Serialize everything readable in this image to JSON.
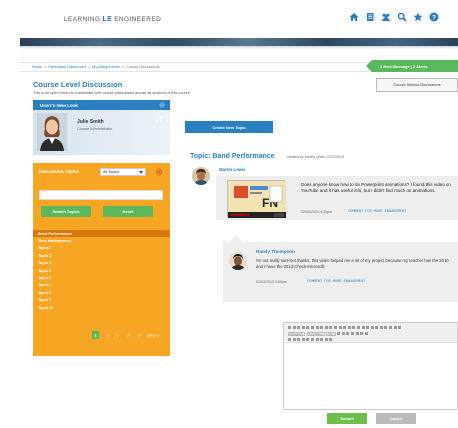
{
  "header": {
    "logo": {
      "part1": "LEARNING",
      "part2": "LE",
      "part3": "ENGINEERED"
    },
    "icons": [
      "home-icon",
      "notebook-icon",
      "group-icon",
      "search-icon",
      "star-icon",
      "help-icon"
    ]
  },
  "breadcrumb": [
    "Home",
    "Participant Dashboard",
    "My Assignments",
    "Course Discussions"
  ],
  "message_tab": "1 New Message | 2 Alerts",
  "page": {
    "title": "Course Level Discussion",
    "description": "This is an open forum to collaborate with course participants across all sections of this course.",
    "section_button": "Course Section Discussions"
  },
  "user": {
    "header": "Userr's New Look",
    "name": "Julie Smith",
    "role": "Course Administrator"
  },
  "topics": {
    "title": "Discussion Topics",
    "filter_value": "All Topics",
    "search_placeholder": "",
    "search_label": "Search Topics",
    "reset_label": "Reset",
    "items": [
      "Band Performance",
      "Time Management",
      "Topic 2",
      "Topic 3",
      "Topic 4",
      "Topic 5",
      "Topic 6",
      "Topic 7",
      "Topic 8",
      "Topic 9",
      "Topic 10"
    ],
    "pager": [
      "1",
      "2",
      "3",
      "4",
      "5",
      "Next »"
    ]
  },
  "create_topic_label": "Create New Topic",
  "thread": {
    "heading": "Topic: Band Performance",
    "meta": "created by Martin Lewis 12/31/2019",
    "post": {
      "author": "Martin Lewis",
      "text": "Does anyone know how to do Powerpoint animations? I found this video on YouTube and it has useful info, but I didn't find much on animations.",
      "date": "02/03/2019 4:30pm",
      "link": "COMMENT FOR MORE ENGAGEMENT"
    },
    "reply": {
      "author": "Randy Thompson",
      "text": "I'm not really sure but thanks, this video helped me a lot of my project because my teacher has the 2010 and I have the 2013 Check Microsoft.",
      "date": "02/03/2019 5:50pm",
      "link": "COMMENT FOR MORE ENGAGEMENT"
    }
  },
  "editor": {
    "format_value": "Paragraph",
    "font_value": "Font Name",
    "size_value": "Size"
  },
  "actions": {
    "submit": "Submit",
    "cancel": "Cancel"
  },
  "colors": {
    "brand_blue": "#2a7fc1",
    "orange": "#f7a623",
    "green": "#5cb85c"
  }
}
